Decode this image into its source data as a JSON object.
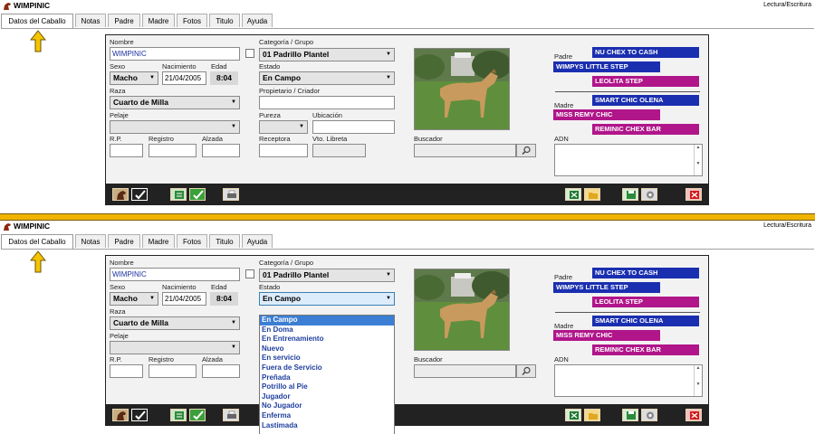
{
  "app": {
    "title": "WIMPINIC",
    "mode": "Lectura/Escritura"
  },
  "tabs": [
    "Datos del Caballo",
    "Notas",
    "Padre",
    "Madre",
    "Fotos",
    "Titulo",
    "Ayuda"
  ],
  "labels": {
    "nombre": "Nombre",
    "sexo": "Sexo",
    "nacimiento": "Nacimiento",
    "edad": "Edad",
    "raza": "Raza",
    "pelaje": "Pelaje",
    "rp": "R.P.",
    "registro": "Registro",
    "alzada": "Alzada",
    "categoria": "Categoría / Grupo",
    "estado": "Estado",
    "propietario": "Propietario / Criador",
    "pureza": "Pureza",
    "ubicacion": "Ubicación",
    "receptora": "Receptora",
    "vto_libreta": "Vto. Libreta",
    "buscador": "Buscador",
    "padre": "Padre",
    "madre": "Madre",
    "adn": "ADN"
  },
  "values": {
    "nombre": "WIMPINIC",
    "sexo": "Macho",
    "nacimiento": "21/04/2005",
    "edad": "8:04",
    "raza": "Cuarto de Milla",
    "pelaje": "",
    "categoria": "01 Padrillo Plantel",
    "estado": "En Campo"
  },
  "pedigree": {
    "sire_sire": "NU CHEX TO CASH",
    "sire": "WIMPYS LITTLE STEP",
    "sire_dam": "LEOLITA STEP",
    "dam_sire": "SMART CHIC OLENA",
    "dam": "MISS REMY CHIC",
    "dam_dam": "REMINIC CHEX BAR"
  },
  "estado_options": [
    "En Campo",
    "En Doma",
    "En Entrenamiento",
    "Nuevo",
    "En servicio",
    "Fuera de Servicio",
    "Preñada",
    "Potrillo al Pie",
    "Jugador",
    "No Jugador",
    "Enferma",
    "Lastimada"
  ],
  "colors": {
    "accent_yellow": "#f0b400",
    "pedigree_blue": "#1a2fb0",
    "pedigree_magenta": "#b0158a",
    "toolbar": "#222222",
    "selection": "#3b7ed4"
  },
  "icons": [
    "horse-icon",
    "check-icon",
    "list-icon",
    "print-icon",
    "excel-icon",
    "folder-icon",
    "save-icon",
    "settings-icon",
    "close-icon",
    "search-icon"
  ]
}
